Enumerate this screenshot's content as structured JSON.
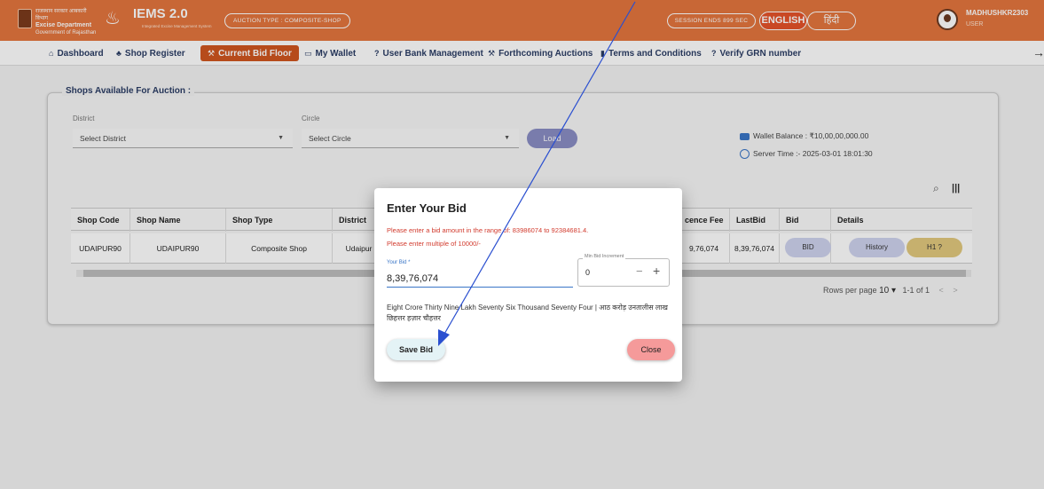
{
  "header": {
    "dept_line1": "राजस्थान सरकार आबकारी विभाग",
    "dept_name": "Excise Department",
    "dept_line2": "Government of Rajasthan",
    "app_title": "IEMS 2.0",
    "app_subtitle": "Integrated Excise Management System",
    "auction_type": "AUCTION TYPE : COMPOSITE-SHOP",
    "session": "SESSION ENDS 899 SEC",
    "lang_english": "ENGLISH",
    "lang_hindi": "हिंदी",
    "user_name": "MADHUSHKR2303",
    "user_role": "USER"
  },
  "nav": {
    "items": [
      {
        "label": "Dashboard",
        "icon": "home-icon"
      },
      {
        "label": "Shop Register",
        "icon": "users-icon"
      },
      {
        "label": "Current Bid Floor",
        "icon": "gavel-icon"
      },
      {
        "label": "My Wallet",
        "icon": "wallet-icon"
      },
      {
        "label": "User Bank Management",
        "icon": "question-icon"
      },
      {
        "label": "Forthcoming Auctions",
        "icon": "gavel-icon"
      },
      {
        "label": "Terms and Conditions",
        "icon": "document-icon"
      },
      {
        "label": "Verify GRN number",
        "icon": "question-icon"
      }
    ],
    "active": "Current Bid Floor"
  },
  "shops": {
    "section_title": "Shops Available For Auction :",
    "district_label": "District",
    "district_value": "Select District",
    "circle_label": "Circle",
    "circle_value": "Select Circle",
    "load_label": "Load",
    "wallet_balance": "Wallet Balance : ₹10,00,00,000.00",
    "server_time": "Server Time :- 2025-03-01 18:01:30",
    "table": {
      "headers": [
        "Shop Code",
        "Shop Name",
        "Shop Type",
        "District",
        "cence Fee",
        "LastBid",
        "Bid",
        "Details"
      ],
      "row": {
        "shop_code": "UDAIPUR90",
        "shop_name": "UDAIPUR90",
        "shop_type": "Composite Shop",
        "district": "Udaipur",
        "licence_fee": "9,76,074",
        "last_bid": "8,39,76,074",
        "bid_button": "BID",
        "history_button": "History",
        "h1_button": "H1 ?"
      }
    },
    "pager": {
      "rows_per_page_label": "Rows per page",
      "rows_per_page": "10 ▾",
      "range": "1-1 of 1"
    }
  },
  "modal": {
    "title": "Enter Your Bid",
    "range_warning": "Please enter a bid amount in the range of: 83986074 to 92384681.4.",
    "multiple_warning": "Please enter multiple of 10000/-",
    "bid_label": "Your Bid *",
    "bid_value": "8,39,76,074",
    "increment_label": "Min Bid Increment",
    "increment_value": "0",
    "amount_words": "Eight Crore Thirty Nine Lakh Seventy Six Thousand Seventy Four | आठ करोड़ उनतालीस लाख छिहत्तर हज़ार चौहत्तर",
    "save_label": "Save Bid",
    "close_label": "Close"
  },
  "colors": {
    "topbar": "#e4763e",
    "active_nav": "#d0561f",
    "annotation_arrow": "#2a4fd0"
  }
}
